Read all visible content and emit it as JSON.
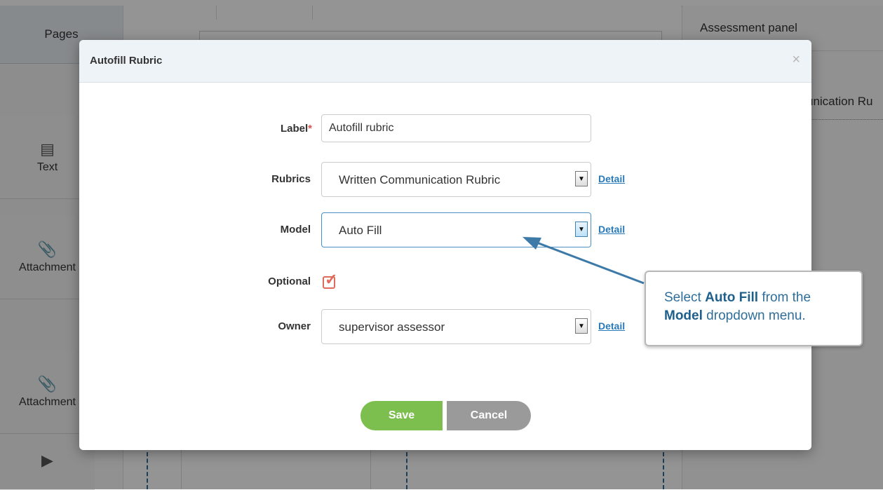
{
  "background": {
    "left_tabs": {
      "pages_label": "Pages",
      "tools": [
        {
          "label": "Text",
          "icon": "document-icon"
        },
        {
          "label": "Attachment",
          "icon": "paperclip-icon"
        },
        {
          "label": "Attachment",
          "icon": "attachment-dashed-icon"
        }
      ]
    },
    "assessment_panel": {
      "title": "Assessment panel",
      "item_fragment": "unication Ru"
    }
  },
  "modal": {
    "title": "Autofill Rubric",
    "close_glyph": "×",
    "fields": {
      "label": {
        "label": "Label",
        "required_mark": "*",
        "value": "Autofill rubric"
      },
      "rubrics": {
        "label": "Rubrics",
        "value": "Written Communication Rubric",
        "detail": "Detail"
      },
      "model": {
        "label": "Model",
        "value": "Auto Fill",
        "detail": "Detail"
      },
      "optional": {
        "label": "Optional",
        "checked": true
      },
      "owner": {
        "label": "Owner",
        "value": "supervisor assessor",
        "detail": "Detail"
      }
    },
    "buttons": {
      "save": "Save",
      "cancel": "Cancel"
    }
  },
  "callout": {
    "part1": "Select ",
    "bold1": "Auto Fill",
    "part2": " from the ",
    "bold2": "Model",
    "part3": " dropdown menu."
  },
  "colors": {
    "save_green": "#7cbf4f",
    "cancel_gray": "#9a9a9a",
    "link_blue": "#2a7ab7",
    "check_red": "#e06b5a",
    "callout_blue": "#2f6e9a"
  }
}
